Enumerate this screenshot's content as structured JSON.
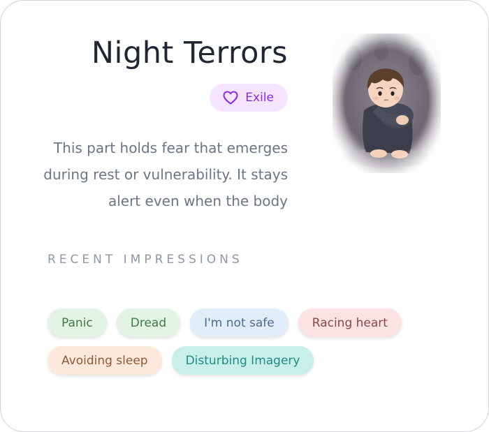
{
  "part": {
    "title": "Night Terrors",
    "badge": {
      "icon": "heart-icon",
      "label": "Exile"
    },
    "description": "This part holds fear that emerges during rest or vulnerability. It stays alert even when the body",
    "portrait": {
      "icon": "child-hugging-knees-illustration"
    }
  },
  "impressions": {
    "heading": "RECENT IMPRESSIONS",
    "tags": [
      {
        "label": "Panic",
        "bg": "#e3f3e4",
        "fg": "#3f7a45"
      },
      {
        "label": "Dread",
        "bg": "#e3f3e4",
        "fg": "#3f7a45"
      },
      {
        "label": "I'm not safe",
        "bg": "#e1edf9",
        "fg": "#4c6b8f"
      },
      {
        "label": "Racing heart",
        "bg": "#fbe3e3",
        "fg": "#8a4545"
      },
      {
        "label": "Avoiding sleep",
        "bg": "#fde9db",
        "fg": "#8d5a36"
      },
      {
        "label": "Disturbing Imagery",
        "bg": "#c9efe9",
        "fg": "#1f8a80"
      }
    ]
  },
  "colors": {
    "title": "#1f2733",
    "badge_bg": "#f5e4fd",
    "badge_fg": "#8a2be2",
    "body_text": "#6b7585",
    "section_title": "#8e97a7"
  }
}
